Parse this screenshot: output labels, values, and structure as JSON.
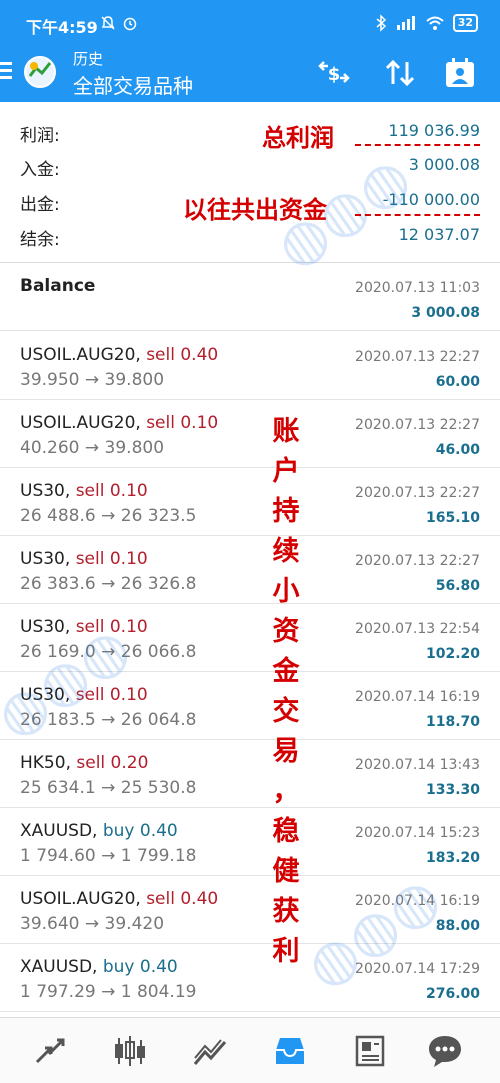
{
  "status_bar": {
    "time": "下午4:59",
    "battery": "32"
  },
  "toolbar": {
    "subtitle": "历史",
    "title": "全部交易品种"
  },
  "summary": [
    {
      "label": "利润:",
      "value": "119 036.99"
    },
    {
      "label": "入金:",
      "value": "3 000.08"
    },
    {
      "label": "出金:",
      "value": "-110 000.00"
    },
    {
      "label": "结余:",
      "value": "12 037.07"
    }
  ],
  "balance": {
    "label": "Balance",
    "time": "2020.07.13 11:03",
    "amount": "3 000.08"
  },
  "deals": [
    {
      "symbol": "USOIL.AUG20,",
      "type": "sell 0.40",
      "side": "sell",
      "price": "39.950 → 39.800",
      "time": "2020.07.13 22:27",
      "profit": "60.00"
    },
    {
      "symbol": "USOIL.AUG20,",
      "type": "sell 0.10",
      "side": "sell",
      "price": "40.260 → 39.800",
      "time": "2020.07.13 22:27",
      "profit": "46.00"
    },
    {
      "symbol": "US30,",
      "type": "sell 0.10",
      "side": "sell",
      "price": "26 488.6 → 26 323.5",
      "time": "2020.07.13 22:27",
      "profit": "165.10"
    },
    {
      "symbol": "US30,",
      "type": "sell 0.10",
      "side": "sell",
      "price": "26 383.6 → 26 326.8",
      "time": "2020.07.13 22:27",
      "profit": "56.80"
    },
    {
      "symbol": "US30,",
      "type": "sell 0.10",
      "side": "sell",
      "price": "26 169.0 → 26 066.8",
      "time": "2020.07.13 22:54",
      "profit": "102.20"
    },
    {
      "symbol": "US30,",
      "type": "sell 0.10",
      "side": "sell",
      "price": "26 183.5 → 26 064.8",
      "time": "2020.07.14 16:19",
      "profit": "118.70"
    },
    {
      "symbol": "HK50,",
      "type": "sell 0.20",
      "side": "sell",
      "price": "25 634.1 → 25 530.8",
      "time": "2020.07.14 13:43",
      "profit": "133.30"
    },
    {
      "symbol": "XAUUSD,",
      "type": "buy 0.40",
      "side": "buy",
      "price": "1 794.60 → 1 799.18",
      "time": "2020.07.14 15:23",
      "profit": "183.20"
    },
    {
      "symbol": "USOIL.AUG20,",
      "type": "sell 0.40",
      "side": "sell",
      "price": "39.640 → 39.420",
      "time": "2020.07.14 16:19",
      "profit": "88.00"
    },
    {
      "symbol": "XAUUSD,",
      "type": "buy 0.40",
      "side": "buy",
      "price": "1 797.29 → 1 804.19",
      "time": "2020.07.14 17:29",
      "profit": "276.00"
    }
  ],
  "annotations": {
    "total_profit": "总利润",
    "past_withdrawals": "以往共出资金",
    "vertical": [
      "账",
      "户",
      "持",
      "续",
      "小",
      "资",
      "金",
      "交",
      "易",
      "，",
      "稳",
      "健",
      "获",
      "利"
    ]
  },
  "colors": {
    "header": "#2196f3",
    "sell": "#b21f2d",
    "buy": "#1a6f8f",
    "profit": "#1a6f8f",
    "annotation": "#d40000"
  },
  "icons": {
    "toolbar": [
      "exchange-dollar-icon",
      "sort-icon",
      "calendar-person-icon"
    ],
    "bottom_nav": [
      "quotes-icon",
      "chart-icon",
      "trade-icon",
      "history-icon",
      "news-icon",
      "chat-icon"
    ],
    "active_nav": "history-icon"
  }
}
